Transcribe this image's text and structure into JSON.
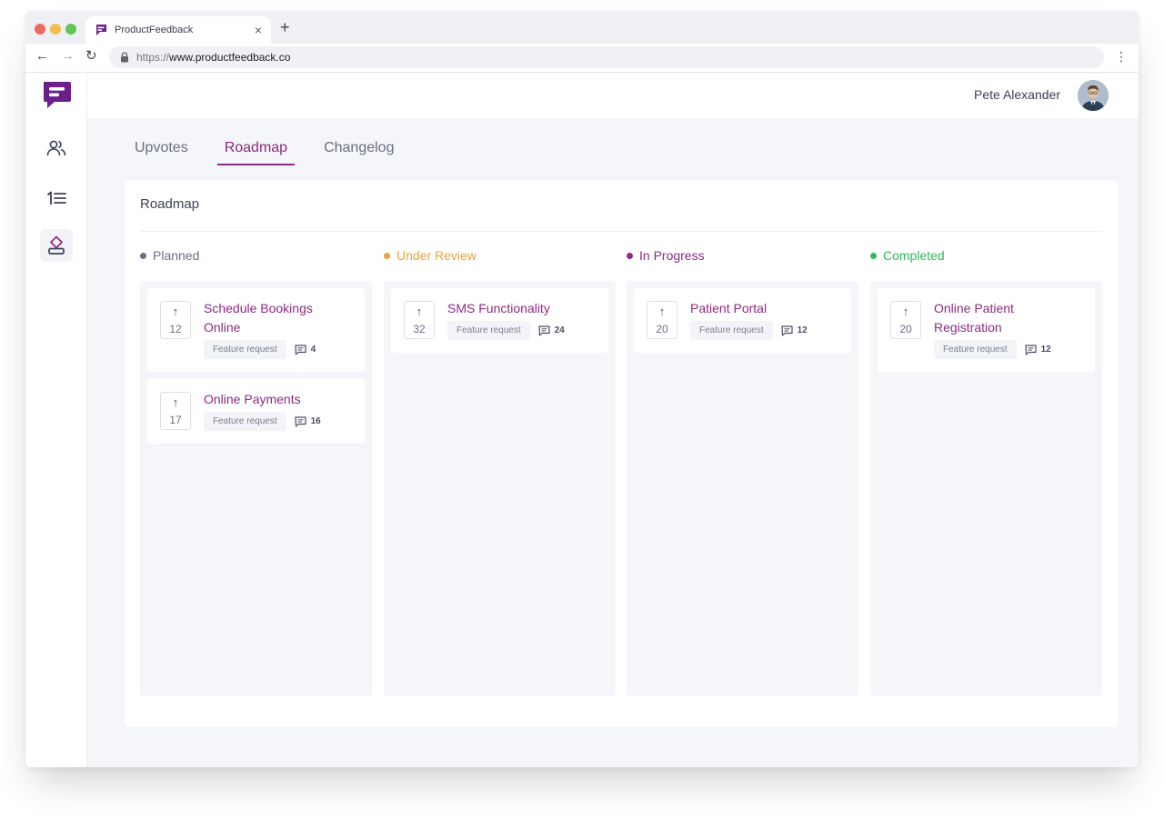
{
  "browser": {
    "tab_title": "ProductFeedback",
    "tab_close": "×",
    "new_tab": "+",
    "url_scheme": "https://",
    "url_host": "www.productfeedback.co",
    "nav_back": "←",
    "nav_forward": "→",
    "nav_reload": "↻",
    "menu": "⋮"
  },
  "colors": {
    "brand": "#8e2a80",
    "planned": "#6b6e84",
    "under_review": "#e8a33d",
    "in_progress": "#8e2a80",
    "completed": "#2fb85c"
  },
  "sidebar": {
    "items": [
      {
        "icon": "users-icon"
      },
      {
        "icon": "ordered-list-icon"
      },
      {
        "icon": "roadmap-icon"
      }
    ]
  },
  "topbar": {
    "user_name": "Pete Alexander"
  },
  "main": {
    "tabs": [
      {
        "label": "Upvotes",
        "active": false
      },
      {
        "label": "Roadmap",
        "active": true
      },
      {
        "label": "Changelog",
        "active": false
      }
    ]
  },
  "roadmap": {
    "title": "Roadmap",
    "columns": [
      {
        "label": "Planned",
        "cards": [
          {
            "title": "Schedule Bookings Online",
            "votes": "12",
            "tag": "Feature request",
            "comments": "4"
          },
          {
            "title": "Online Payments",
            "votes": "17",
            "tag": "Feature request",
            "comments": "16"
          }
        ]
      },
      {
        "label": "Under Review",
        "cards": [
          {
            "title": "SMS Functionality",
            "votes": "32",
            "tag": "Feature request",
            "comments": "24"
          }
        ]
      },
      {
        "label": "In Progress",
        "cards": [
          {
            "title": "Patient Portal",
            "votes": "20",
            "tag": "Feature request",
            "comments": "12"
          }
        ]
      },
      {
        "label": "Completed",
        "cards": [
          {
            "title": "Online Patient Registration",
            "votes": "20",
            "tag": "Feature request",
            "comments": "12"
          }
        ]
      }
    ],
    "vote_arrow": "↑"
  }
}
